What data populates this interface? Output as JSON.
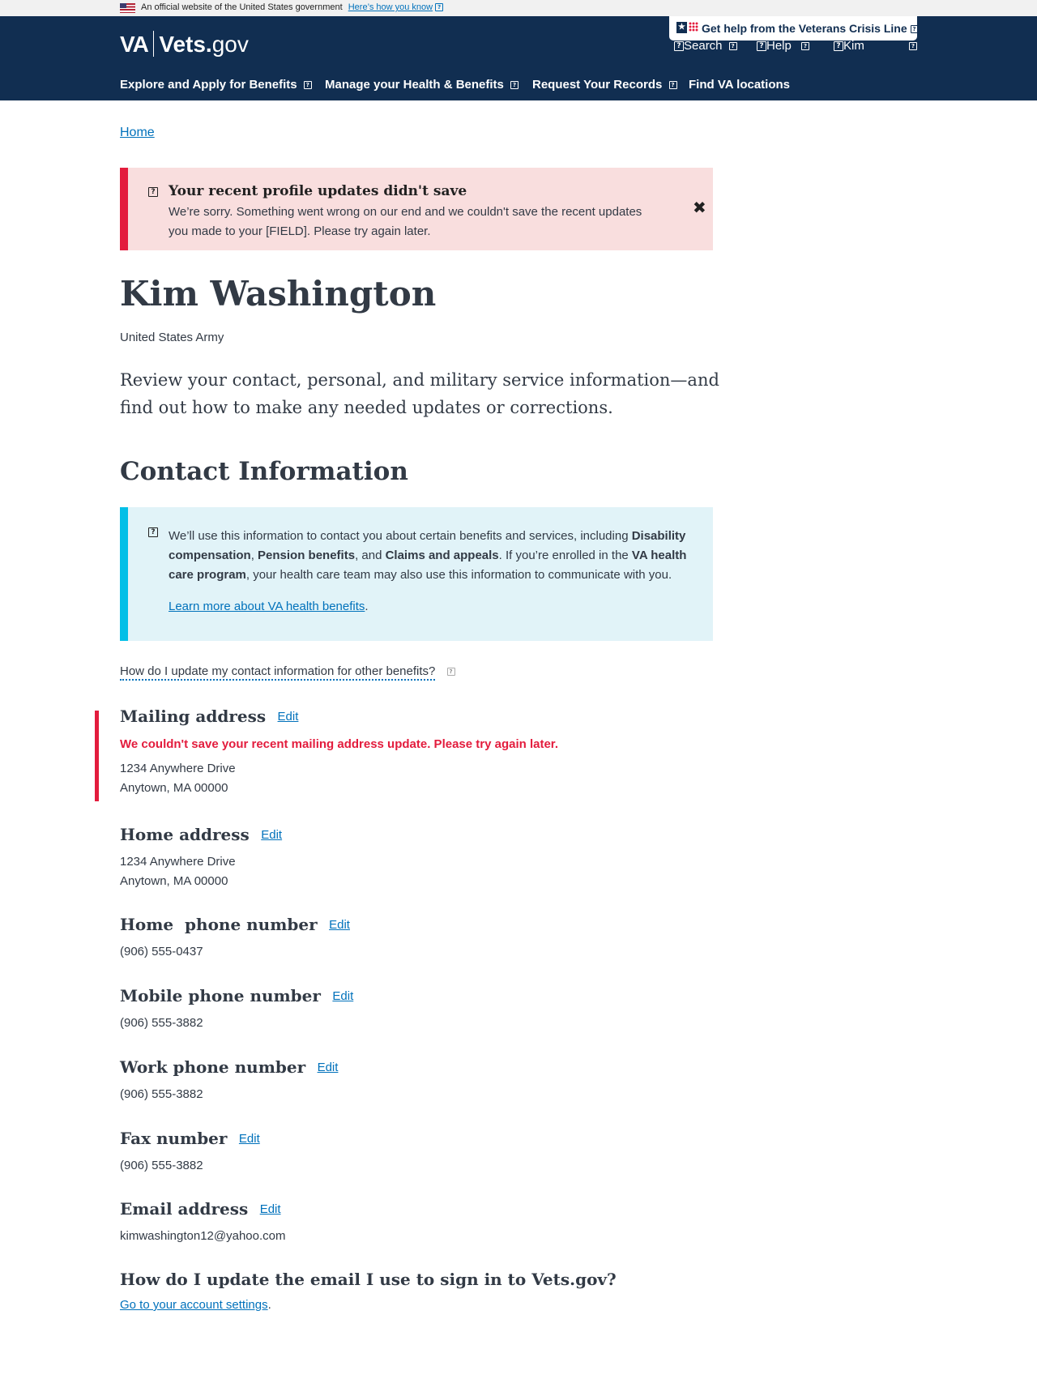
{
  "gov_banner": {
    "text": "An official website of the United States government",
    "link": "Here’s how you know"
  },
  "header": {
    "logo_va": "VA",
    "logo_vets": "Vets.",
    "logo_gov": "gov",
    "crisis_line": "Get help from the Veterans Crisis Line",
    "search": "Search",
    "help": "Help",
    "user": "Kim",
    "nav": [
      "Explore and Apply for Benefits",
      "Manage your Health & Benefits",
      "Request Your Records",
      "Find VA locations"
    ]
  },
  "breadcrumb": "Home",
  "error_alert": {
    "title": "Your recent profile updates didn't save",
    "body": "We’re sorry. Something went wrong on our end and we couldn't save the recent updates you made to your [FIELD]. Please try again later.",
    "close": "✖"
  },
  "profile": {
    "name": "Kim Washington",
    "branch": "United States Army",
    "intro": "Review your contact, personal, and military service information—and find out how to make any needed updates or corrections."
  },
  "contact": {
    "title": "Contact Information",
    "info_alert": {
      "p1": "We’ll use this information to contact you about certain benefits and services, including ",
      "b1": "Disability compensation",
      "p2": ", ",
      "b2": "Pension benefits",
      "p3": ", and ",
      "b3": "Claims and appeals",
      "p4": ". If you’re enrolled in the ",
      "b4": "VA health care program",
      "p5": ", your health care team may also use this information to communicate with you.",
      "link": "Learn more about VA health benefits",
      "link_suffix": "."
    },
    "help_question": "How do I update my contact information for other benefits?",
    "edit_label": "Edit",
    "mailing": {
      "label": "Mailing address",
      "error": "We couldn't save your recent mailing address update. Please try again later.",
      "line1": "1234 Anywhere Drive",
      "line2": "Anytown, MA 00000"
    },
    "home_address": {
      "label": "Home address",
      "line1": "1234 Anywhere Drive",
      "line2": "Anytown, MA 00000"
    },
    "home_phone": {
      "label": "Home  phone number",
      "value": "(906) 555-0437"
    },
    "mobile_phone": {
      "label": "Mobile phone number",
      "value": "(906) 555-3882"
    },
    "work_phone": {
      "label": "Work phone number",
      "value": "(906) 555-3882"
    },
    "fax": {
      "label": "Fax number",
      "value": "(906) 555-3882"
    },
    "email": {
      "label": "Email address",
      "value": "kimwashington12@yahoo.com"
    },
    "signin_title": "How do I update the email I use to sign in to Vets.gov?",
    "signin_link": "Go to your account settings",
    "signin_suffix": "."
  },
  "colors": {
    "header_bg": "#112e51",
    "error_red": "#e31c3d",
    "info_cyan": "#02bfe7",
    "link_blue": "#0071bb"
  }
}
